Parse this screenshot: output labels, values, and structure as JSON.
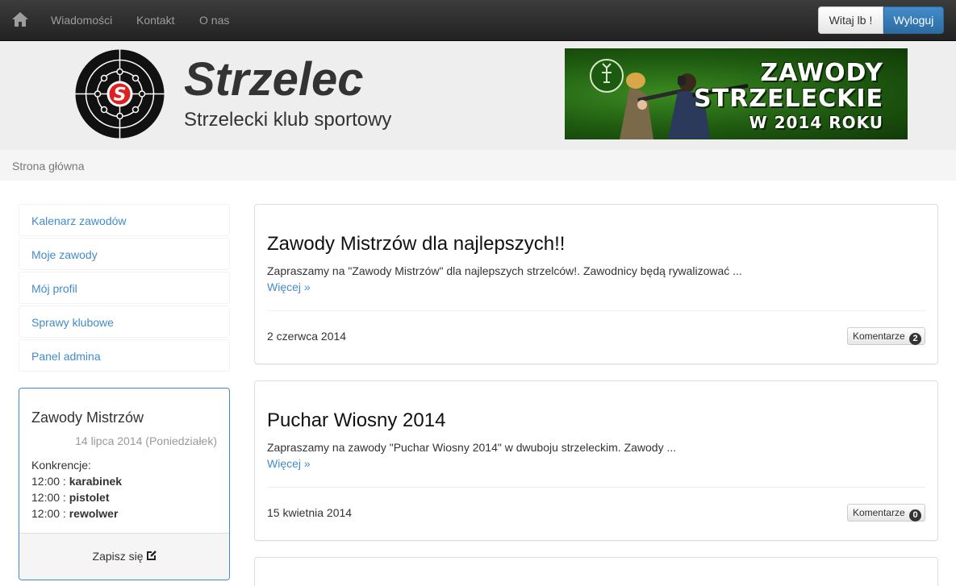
{
  "navbar": {
    "links": [
      "Wiadomości",
      "Kontakt",
      "O nas"
    ],
    "greeting": "Witaj lb !",
    "logout": "Wyloguj"
  },
  "header": {
    "title": "Strzelec",
    "subtitle": "Strzelecki klub sportowy",
    "logo_letter": "S",
    "banner": {
      "line1": "ZAWODY",
      "line2": "STRZELECKIE",
      "line3": "W 2014 ROKU"
    }
  },
  "breadcrumb": "Strona główna",
  "sidebar": {
    "menu": [
      "Kalenarz zawodów",
      "Moje zawody",
      "Mój profil",
      "Sprawy klubowe",
      "Panel admina"
    ],
    "event": {
      "title": "Zawody Mistrzów",
      "date": "14 lipca 2014 (Poniedziałek)",
      "competitions_label": "Konkrencje:",
      "competitions": [
        {
          "time": "12:00 : ",
          "name": "karabinek"
        },
        {
          "time": "12:00 : ",
          "name": "pistolet"
        },
        {
          "time": "12:00 : ",
          "name": "rewolwer"
        }
      ],
      "signup_label": "Zapisz się"
    }
  },
  "articles": [
    {
      "title": "Zawody Mistrzów dla najlepszych!!",
      "excerpt": "Zapraszamy na \"Zawody Mistrzów\" dla najlepszych strzelców!. Zawodnicy będą rywalizować ...",
      "more": "Więcej »",
      "date": "2 czerwca 2014",
      "comments_label": "Komentarze",
      "comments_count": "2"
    },
    {
      "title": "Puchar Wiosny 2014",
      "excerpt": "Zapraszamy na zawody \"Puchar Wiosny 2014\" w dwuboju strzeleckim. Zawody ...",
      "more": "Więcej »",
      "date": "15 kwietnia 2014",
      "comments_label": "Komentarze",
      "comments_count": "0"
    }
  ],
  "colors": {
    "accent": "#428bca",
    "navbar": "#2b2b2b",
    "header_bg": "#eeeeee"
  },
  "icons": [
    "home-icon",
    "target-logo",
    "edit-icon"
  ]
}
